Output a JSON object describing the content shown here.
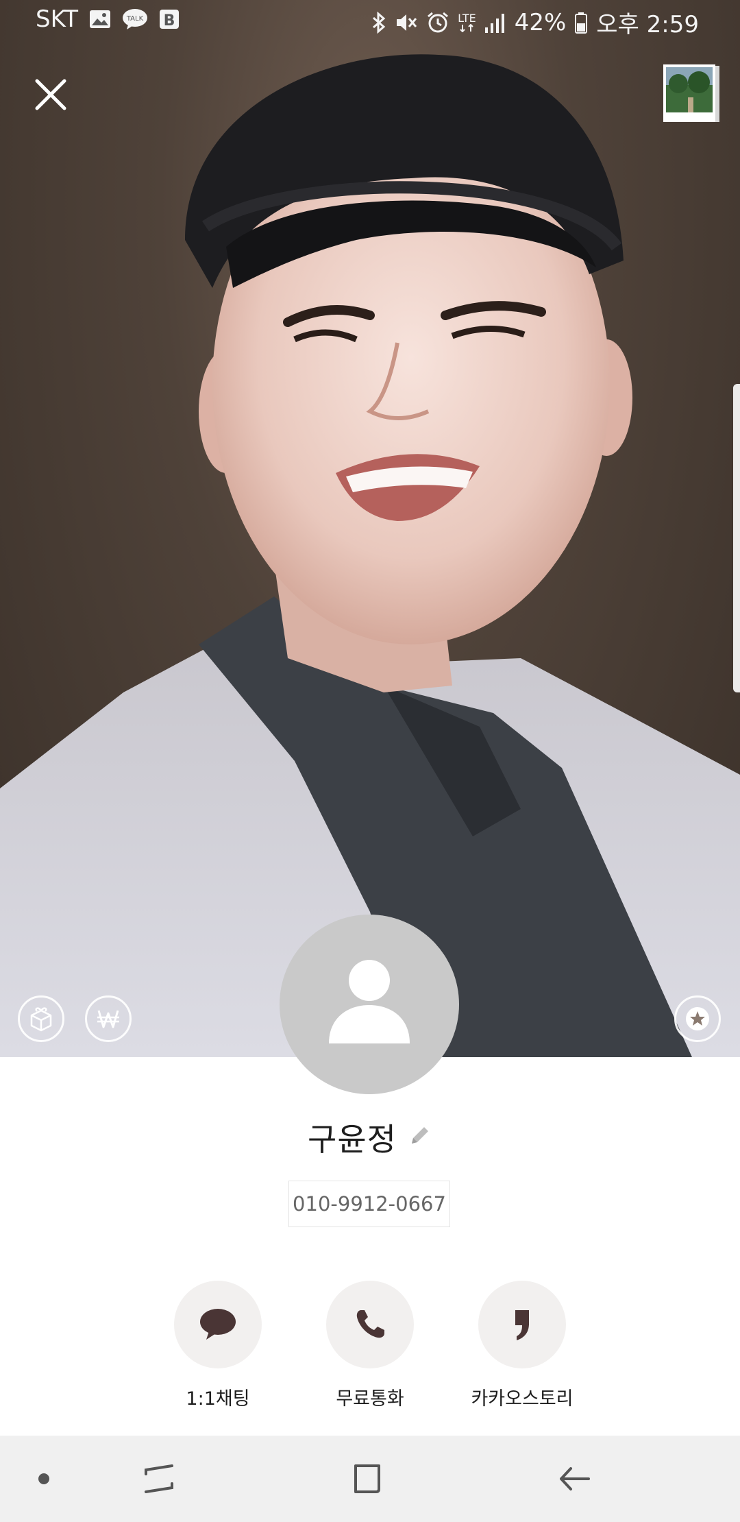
{
  "status_bar": {
    "carrier": "SKT",
    "network": "LTE",
    "battery": "42%",
    "time": "오후 2:59",
    "icons": [
      "gallery-icon",
      "kakaotalk-icon",
      "b-app-icon",
      "bluetooth-icon",
      "mute-icon",
      "alarm-icon",
      "lte-icon",
      "signal-icon",
      "battery-icon"
    ]
  },
  "profile": {
    "name": "구윤정",
    "phone": "010-9912-0667"
  },
  "actions": [
    {
      "label": "1:1채팅",
      "icon": "chat-bubble-icon"
    },
    {
      "label": "무료통화",
      "icon": "phone-icon"
    },
    {
      "label": "카카오스토리",
      "icon": "kakaostory-icon"
    }
  ],
  "colors": {
    "action_icon": "#4a3535",
    "action_bg": "#f2f0ef",
    "avatar_bg": "#c9c9c9",
    "navbar_bg": "#f0f0f0"
  }
}
